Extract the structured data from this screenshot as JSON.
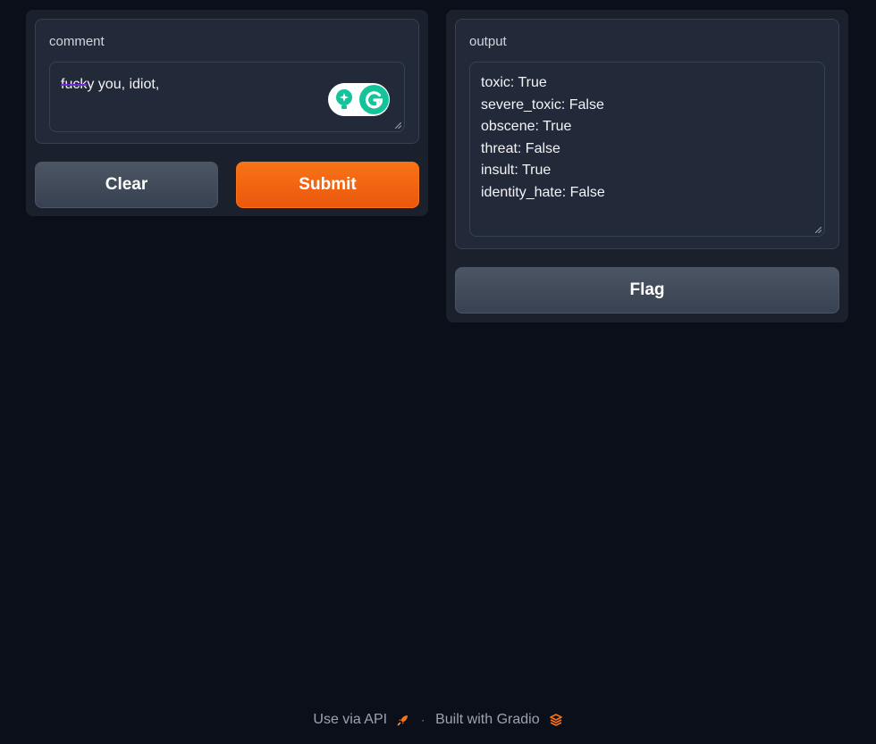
{
  "inputs": {
    "comment_label": "comment",
    "comment_value_struck": "fuck",
    "comment_value_rest": "y you, idiot,",
    "clear_label": "Clear",
    "submit_label": "Submit"
  },
  "outputs": {
    "output_label": "output",
    "lines": [
      "toxic: True",
      "severe_toxic: False",
      "obscene: True",
      "threat: False",
      "insult: True",
      "identity_hate: False"
    ],
    "flag_label": "Flag"
  },
  "footer": {
    "api_label": "Use via API",
    "separator": "·",
    "built_label": "Built with Gradio"
  },
  "colors": {
    "background": "#0b0f19",
    "panel": "#1a202c",
    "block": "#222939",
    "accent": "#f97316",
    "grammarly_green": "#15c39a"
  },
  "icons": {
    "api": "rocket-icon",
    "gradio": "gradio-logo-icon",
    "grammarly_assist": "lightbulb-icon",
    "grammarly": "grammarly-icon"
  }
}
